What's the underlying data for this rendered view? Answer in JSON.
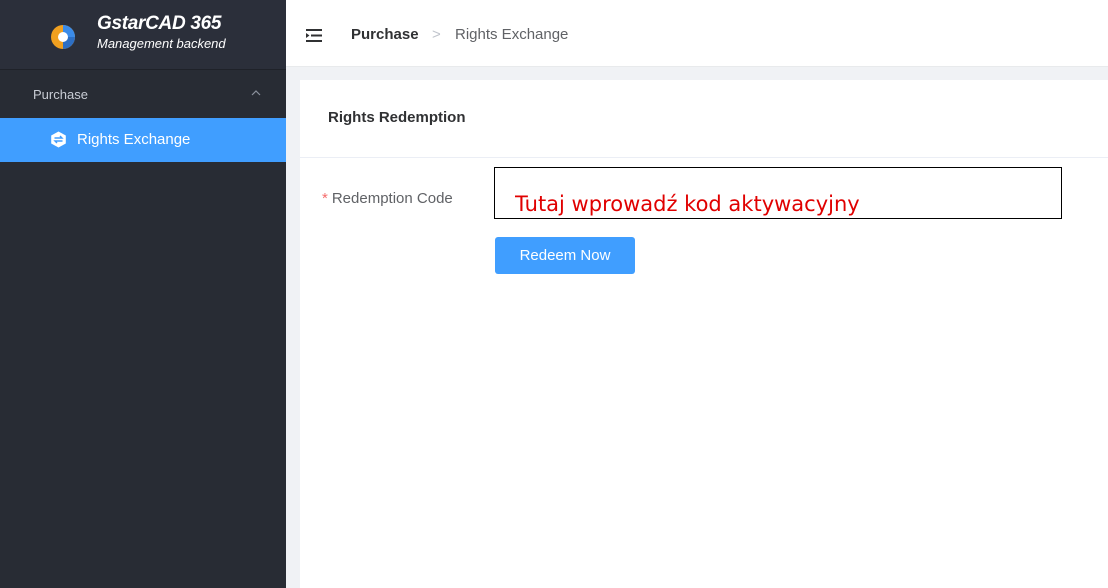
{
  "app": {
    "title": "GstarCAD 365",
    "subtitle": "Management backend"
  },
  "sidebar": {
    "group_label": "Purchase",
    "active_item": "Rights Exchange"
  },
  "header": {
    "breadcrumb": [
      "Purchase",
      "Rights Exchange"
    ],
    "separator": ">"
  },
  "card": {
    "title": "Rights Redemption",
    "field_label": "Redemption Code",
    "required_mark": "*",
    "input_value": "",
    "input_placeholder": "Tutaj wprowadź kod aktywacyjny",
    "button_label": "Redeem Now"
  },
  "colors": {
    "sidebar_bg": "#282c34",
    "accent": "#409eff",
    "annotation": "#e00000"
  }
}
